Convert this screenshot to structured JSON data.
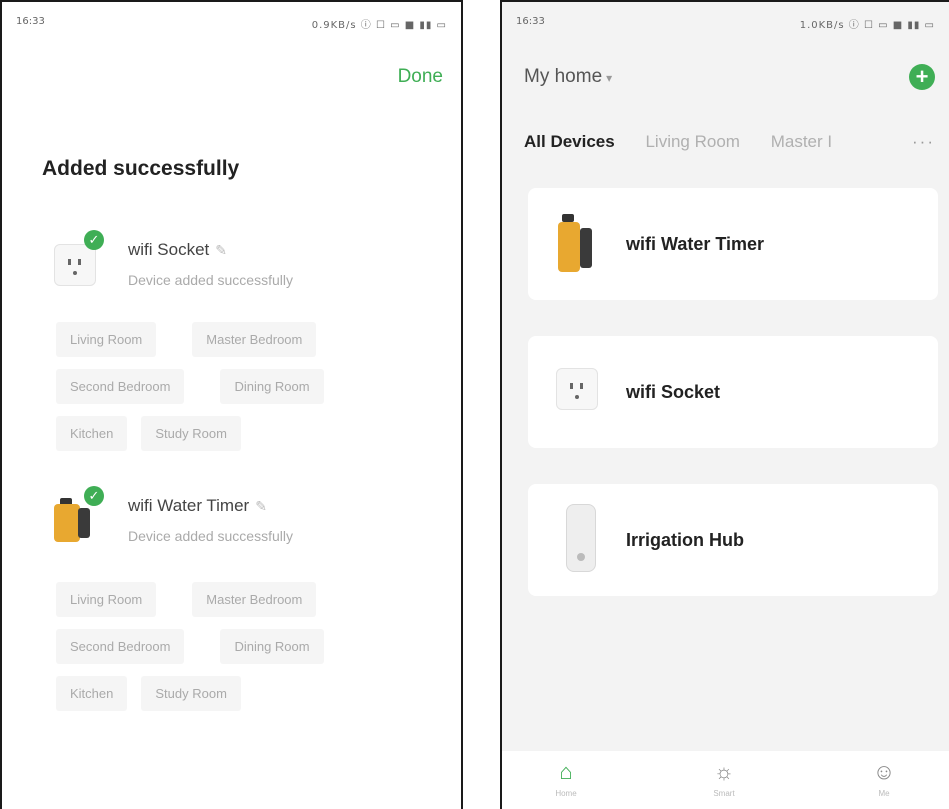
{
  "left_screen": {
    "status": {
      "time": "16:33",
      "icons": "0.9KB/s ⓘ ☐ ▭ ■ ▮▮ ▭"
    },
    "done_label": "Done",
    "title": "Added successfully",
    "devices": [
      {
        "name": "wifi Socket",
        "status": "Device added successfully",
        "rooms": [
          [
            "Living Room",
            "Master Bedroom"
          ],
          [
            "Second Bedroom",
            "Dining Room"
          ],
          [
            "Kitchen",
            "Study Room"
          ]
        ]
      },
      {
        "name": "wifi Water Timer",
        "status": "Device added successfully",
        "rooms": [
          [
            "Living Room",
            "Master Bedroom"
          ],
          [
            "Second Bedroom",
            "Dining Room"
          ],
          [
            "Kitchen",
            "Study Room"
          ]
        ]
      }
    ]
  },
  "right_screen": {
    "status": {
      "time": "16:33",
      "icons": "1.0KB/s ⓘ ☐ ▭ ■ ▮▮ ▭"
    },
    "home_title": "My home",
    "tabs": [
      "All Devices",
      "Living Room",
      "Master I"
    ],
    "devices": [
      "wifi Water Timer",
      "wifi Socket",
      "Irrigation Hub"
    ],
    "nav": [
      "Home",
      "Smart",
      "Me"
    ]
  },
  "colors": {
    "accent": "#3fae55",
    "timer_orange": "#e8a830"
  },
  "icons": {
    "done": "check-icon",
    "edit": "pencil-icon",
    "add": "plus-circle-icon",
    "home": "home-icon",
    "smart": "sun-icon",
    "me": "user-icon",
    "more": "ellipsis-icon"
  }
}
